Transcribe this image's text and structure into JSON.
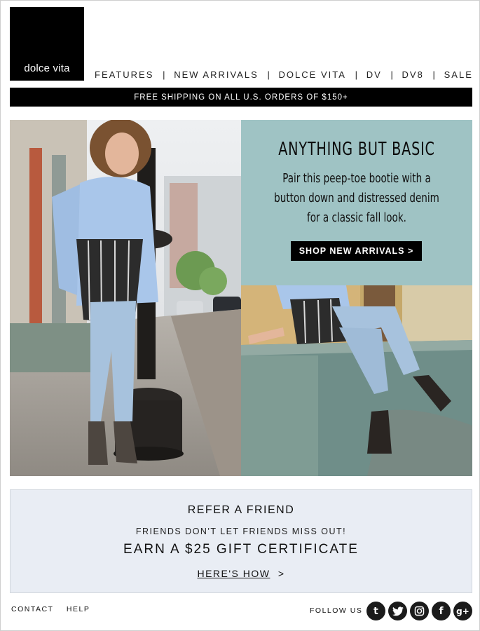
{
  "brand": {
    "logo_text": "dolce vita"
  },
  "nav": {
    "items": [
      "FEATURES",
      "NEW ARRIVALS",
      "DOLCE VITA",
      "DV",
      "DV8",
      "SALE"
    ],
    "separator": "|"
  },
  "banner": {
    "shipping_text": "FREE SHIPPING ON ALL U.S. ORDERS OF $150+"
  },
  "promo": {
    "headline": "ANYTHING BUT BASIC",
    "body": "Pair this peep-toe bootie with a button down and distressed denim for a classic fall look.",
    "cta_label": "SHOP NEW ARRIVALS >",
    "bg_color": "#9fc3c4"
  },
  "refer": {
    "title": "REFER A FRIEND",
    "subtitle": "FRIENDS DON'T LET FRIENDS MISS OUT!",
    "offer": "EARN A $25 GIFT CERTIFICATE",
    "link_label": "HERE'S HOW",
    "link_chevron": ">"
  },
  "footer": {
    "links": [
      "CONTACT",
      "HELP"
    ],
    "follow_label": "FOLLOW US",
    "socials": [
      "tumblr-icon",
      "twitter-icon",
      "instagram-icon",
      "facebook-icon",
      "google-plus-icon"
    ]
  }
}
